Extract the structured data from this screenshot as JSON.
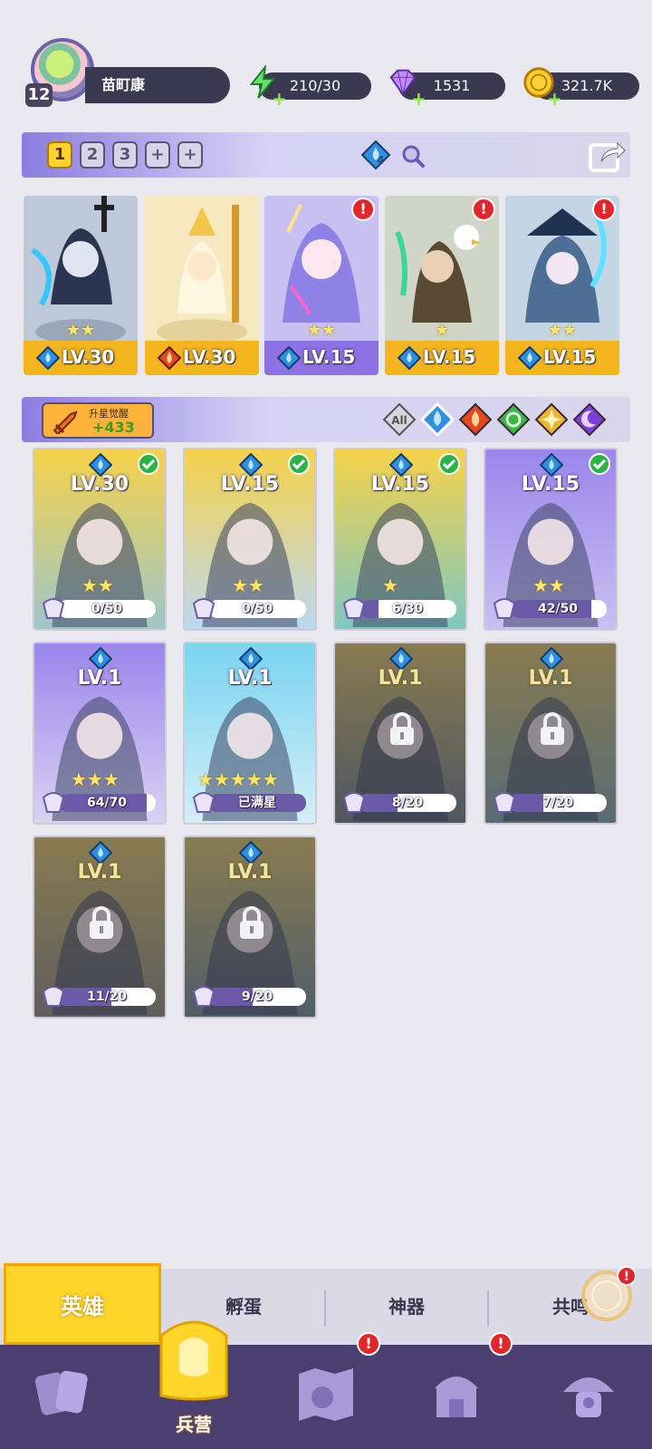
{
  "player": {
    "level": "12",
    "name": "苗町康"
  },
  "resources": {
    "energy": "210/30",
    "gems": "1531",
    "gold": "321.7K"
  },
  "team": {
    "slots": [
      "1",
      "2",
      "3",
      "+",
      "+"
    ],
    "active_slot": "1",
    "element_count": "4",
    "members": [
      {
        "level": "LV.30",
        "element": "water",
        "stars": "★★",
        "badge": ""
      },
      {
        "level": "LV.30",
        "element": "fire",
        "stars": "",
        "badge": ""
      },
      {
        "level": "LV.15",
        "element": "water",
        "stars": "★★",
        "badge": "!"
      },
      {
        "level": "LV.15",
        "element": "water",
        "stars": "★",
        "badge": "!"
      },
      {
        "level": "LV.15",
        "element": "water",
        "stars": "★★",
        "badge": "!"
      }
    ]
  },
  "filter": {
    "awaken_title": "升星觉醒",
    "awaken_value": "+433",
    "all_label": "All",
    "elements": [
      "all",
      "water",
      "fire",
      "wind",
      "light",
      "dark"
    ]
  },
  "heroes": [
    {
      "level": "LV.30",
      "progress": "0/50",
      "fill": 0,
      "stars": "★★",
      "owned": true,
      "checked": true
    },
    {
      "level": "LV.15",
      "progress": "0/50",
      "fill": 0,
      "stars": "★★",
      "owned": true,
      "checked": true
    },
    {
      "level": "LV.15",
      "progress": "6/30",
      "fill": 0.2,
      "stars": "★",
      "owned": true,
      "checked": true
    },
    {
      "level": "LV.15",
      "progress": "42/50",
      "fill": 0.84,
      "stars": "★★",
      "owned": true,
      "checked": true
    },
    {
      "level": "LV.1",
      "progress": "64/70",
      "fill": 0.91,
      "stars": "★★★",
      "owned": true,
      "checked": false
    },
    {
      "level": "LV.1",
      "progress": "已满星",
      "fill": 1,
      "stars": "★★★★★",
      "owned": true,
      "checked": false
    },
    {
      "level": "LV.1",
      "progress": "8/20",
      "fill": 0.4,
      "stars": "",
      "owned": false,
      "checked": false
    },
    {
      "level": "LV.1",
      "progress": "7/20",
      "fill": 0.35,
      "stars": "",
      "owned": false,
      "checked": false
    },
    {
      "level": "LV.1",
      "progress": "11/20",
      "fill": 0.55,
      "stars": "",
      "owned": false,
      "checked": false
    },
    {
      "level": "LV.1",
      "progress": "9/20",
      "fill": 0.45,
      "stars": "",
      "owned": false,
      "checked": false
    }
  ],
  "subtabs": [
    "英雄",
    "孵蛋",
    "神器",
    "共鸣"
  ],
  "nav": {
    "active_label": "兵营",
    "badges": [
      "",
      "",
      "!",
      "!",
      ""
    ]
  },
  "colors": {
    "accent_yellow": "#ffd52a",
    "nav_bg": "#4a3f6e",
    "badge_red": "#e2262c",
    "water": "#2f8fe0",
    "fire": "#e5471f"
  }
}
